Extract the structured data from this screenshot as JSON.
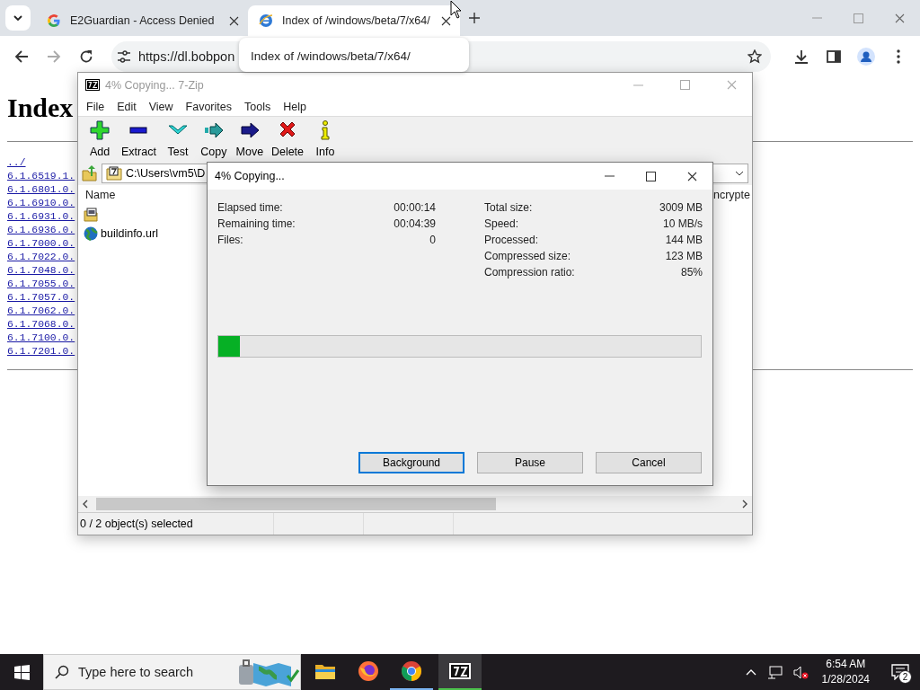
{
  "browser": {
    "tabs": [
      {
        "title": "E2Guardian - Access Denied",
        "kind": "google",
        "selected": false
      },
      {
        "title": "Index of /windows/beta/7/x64/",
        "kind": "ie",
        "selected": true
      }
    ],
    "url": "https://dl.bobpon",
    "tooltip": "Index of /windows/beta/7/x64/"
  },
  "page": {
    "heading": "Index",
    "links": [
      "../",
      "6.1.6519.1.",
      "6.1.6801.0.",
      "6.1.6910.0.",
      "6.1.6931.0.",
      "6.1.6936.0.",
      "6.1.7000.0.",
      "6.1.7022.0.",
      "6.1.7048.0.",
      "6.1.7055.0.",
      "6.1.7057.0.",
      "6.1.7062.0.",
      "6.1.7068.0.",
      "6.1.7100.0.",
      "6.1.7201.0."
    ]
  },
  "sevenzip": {
    "title": "4% Copying... 7-Zip",
    "menu": [
      "File",
      "Edit",
      "View",
      "Favorites",
      "Tools",
      "Help"
    ],
    "toolbar": [
      {
        "label": "Add",
        "kind": "add"
      },
      {
        "label": "Extract",
        "kind": "extract"
      },
      {
        "label": "Test",
        "kind": "test"
      },
      {
        "label": "Copy",
        "kind": "copy"
      },
      {
        "label": "Move",
        "kind": "move"
      },
      {
        "label": "Delete",
        "kind": "delete"
      },
      {
        "label": "Info",
        "kind": "info"
      }
    ],
    "path": "C:\\Users\\vm5\\D",
    "columns": [
      "Name",
      "ncrypte"
    ],
    "files": [
      {
        "kind": "iso"
      },
      {
        "kind": "url",
        "name": "buildinfo.url"
      }
    ],
    "status": "0 / 2 object(s) selected"
  },
  "dialog": {
    "title": "4% Copying...",
    "left_stats": [
      {
        "label": "Elapsed time:",
        "value": "00:00:14"
      },
      {
        "label": "Remaining time:",
        "value": "00:04:39"
      },
      {
        "label": "Files:",
        "value": "0"
      }
    ],
    "right_stats": [
      {
        "label": "Total size:",
        "value": "3009 MB"
      },
      {
        "label": "Speed:",
        "value": "10 MB/s"
      },
      {
        "label": "Processed:",
        "value": "144 MB"
      },
      {
        "label": "Compressed size:",
        "value": "123 MB"
      },
      {
        "label": "Compression ratio:",
        "value": "85%"
      }
    ],
    "progress": {
      "level": 0.045
    },
    "buttons": [
      {
        "label": "Background",
        "selected": true
      },
      {
        "label": "Pause",
        "selected": false
      },
      {
        "label": "Cancel",
        "selected": false
      }
    ]
  },
  "taskbar": {
    "search_placeholder": "Type here to search",
    "apps": [
      {
        "kind": "explorer",
        "running": false,
        "selected": false
      },
      {
        "kind": "firefox",
        "running": false,
        "selected": false
      },
      {
        "kind": "chrome",
        "running": true,
        "selected": false
      },
      {
        "kind": "sevenzip",
        "running": true,
        "selected": true
      }
    ],
    "time": "6:54 AM",
    "date": "1/28/2024",
    "notifications": "2"
  }
}
